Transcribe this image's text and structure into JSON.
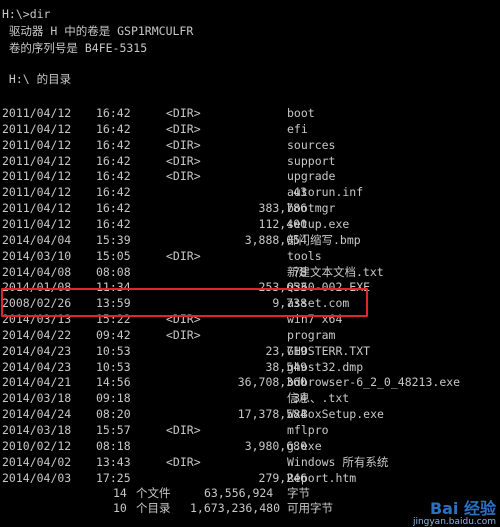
{
  "window": {
    "prompt_line": "H:\\>dir",
    "volume_line": " 驱动器 H 中的卷是 GSP1RMCULFR",
    "serial_line": " 卷的序列号是 B4FE-5315",
    "dir_header": " H:\\ 的目录"
  },
  "listing": [
    {
      "date": "2011/04/12",
      "time": "16:42",
      "dir": "<DIR>",
      "size": "",
      "name": "boot"
    },
    {
      "date": "2011/04/12",
      "time": "16:42",
      "dir": "<DIR>",
      "size": "",
      "name": "efi"
    },
    {
      "date": "2011/04/12",
      "time": "16:42",
      "dir": "<DIR>",
      "size": "",
      "name": "sources"
    },
    {
      "date": "2011/04/12",
      "time": "16:42",
      "dir": "<DIR>",
      "size": "",
      "name": "support"
    },
    {
      "date": "2011/04/12",
      "time": "16:42",
      "dir": "<DIR>",
      "size": "",
      "name": "upgrade"
    },
    {
      "date": "2011/04/12",
      "time": "16:42",
      "dir": "",
      "size": "43",
      "name": "autorun.inf"
    },
    {
      "date": "2011/04/12",
      "time": "16:42",
      "dir": "",
      "size": "383,786",
      "name": "bootmgr"
    },
    {
      "date": "2011/04/12",
      "time": "16:42",
      "dir": "",
      "size": "112,400",
      "name": "setup.exe"
    },
    {
      "date": "2014/04/04",
      "time": "15:39",
      "dir": "",
      "size": "3,888,054",
      "name": "部门缩写.bmp"
    },
    {
      "date": "2014/03/10",
      "time": "15:05",
      "dir": "<DIR>",
      "size": "",
      "name": "tools"
    },
    {
      "date": "2014/04/08",
      "time": "08:08",
      "dir": "",
      "size": "78",
      "name": "新建文本文档.txt"
    },
    {
      "date": "2014/01/08",
      "time": "11:34",
      "dir": "",
      "size": "253,653",
      "name": "Q360-002.EXE"
    },
    {
      "date": "2008/02/26",
      "time": "13:59",
      "dir": "",
      "size": "9,738",
      "name": "asset.com"
    },
    {
      "date": "2014/03/13",
      "time": "15:22",
      "dir": "<DIR>",
      "size": "",
      "name": "win7 x64"
    },
    {
      "date": "2014/04/22",
      "time": "09:42",
      "dir": "<DIR>",
      "size": "",
      "name": "program"
    },
    {
      "date": "2014/04/23",
      "time": "10:53",
      "dir": "",
      "size": "23,719",
      "name": "GHOSTERR.TXT"
    },
    {
      "date": "2014/04/23",
      "time": "10:53",
      "dir": "",
      "size": "38,549",
      "name": "ghost32.dmp"
    },
    {
      "date": "2014/04/21",
      "time": "14:56",
      "dir": "",
      "size": "36,708,360",
      "name": "bdbrowser-6_2_0_48213.exe"
    },
    {
      "date": "2014/03/18",
      "time": "09:18",
      "dir": "",
      "size": "34",
      "name": "信息、.txt"
    },
    {
      "date": "2014/04/24",
      "time": "08:20",
      "dir": "",
      "size": "17,378,584",
      "name": "WxBoxSetup.exe"
    },
    {
      "date": "2014/03/18",
      "time": "15:57",
      "dir": "<DIR>",
      "size": "",
      "name": "mflpro"
    },
    {
      "date": "2010/02/12",
      "time": "08:18",
      "dir": "",
      "size": "3,980,680",
      "name": "g.exe"
    },
    {
      "date": "2014/04/02",
      "time": "13:43",
      "dir": "<DIR>",
      "size": "",
      "name": "Windows 所有系统"
    },
    {
      "date": "2014/04/03",
      "time": "17:25",
      "dir": "",
      "size": "279,246",
      "name": "Report.htm"
    }
  ],
  "summary": {
    "files_count": "14",
    "files_label": "个文件",
    "files_bytes": "63,556,924",
    "files_bytes_label": "字节",
    "dirs_count": "10",
    "dirs_label": "个目录",
    "free_bytes": "1,673,236,480",
    "free_label": "可用字节"
  },
  "watermark": {
    "logo": "Bai 经验",
    "url": "jingyan.baidu.com"
  },
  "colors": {
    "background": "#000000",
    "text": "#c8c8c8",
    "highlight": "#e0262b",
    "watermark": "#2f7fd6"
  }
}
